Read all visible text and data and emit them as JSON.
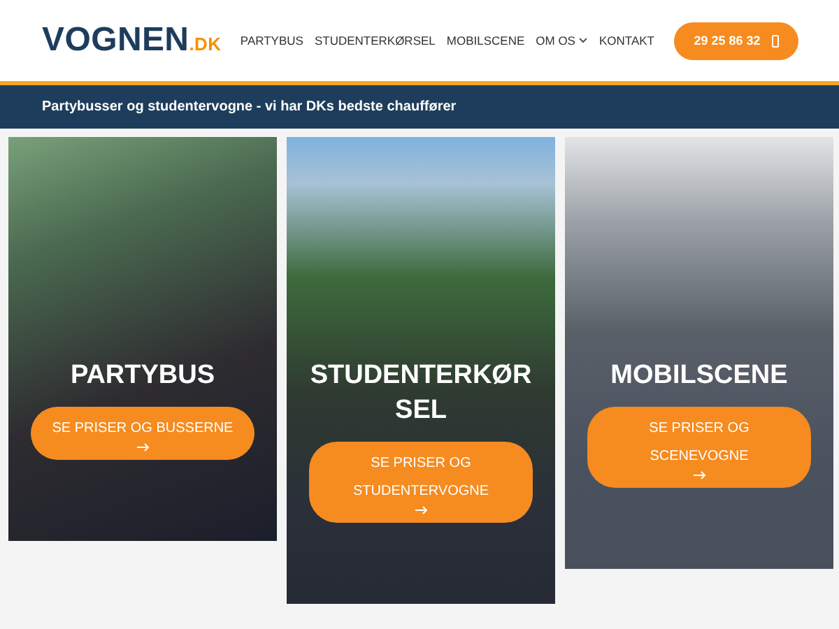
{
  "header": {
    "logo": {
      "name": "VOGNEN",
      "suffix": ".DK"
    },
    "nav": [
      {
        "label": "PARTYBUS",
        "has_dropdown": false
      },
      {
        "label": "STUDENTERKØRSEL",
        "has_dropdown": false
      },
      {
        "label": "MOBILSCENE",
        "has_dropdown": false
      },
      {
        "label": "OM OS",
        "has_dropdown": true
      },
      {
        "label": "KONTAKT",
        "has_dropdown": false
      }
    ],
    "phone_button": "29 25 86 32"
  },
  "banner": "Partybusser og studentervogne - vi har DKs bedste chauffører",
  "cards": [
    {
      "title": "PARTYBUS",
      "button": "SE PRISER OG BUSSERNE"
    },
    {
      "title": "STUDENTERKØRSEL",
      "button": "SE PRISER OG STUDENTERVOGNE"
    },
    {
      "title": "MOBILSCENE",
      "button": "SE PRISER OG SCENEVOGNE"
    }
  ]
}
